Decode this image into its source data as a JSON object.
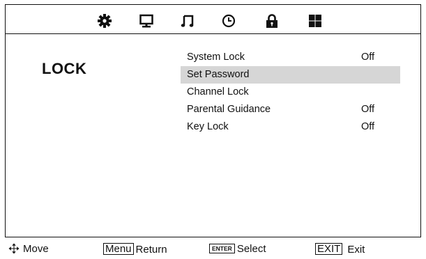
{
  "top_icons": [
    "settings-icon",
    "picture-icon",
    "audio-icon",
    "time-icon",
    "lock-icon",
    "app-grid-icon"
  ],
  "section_title": "LOCK",
  "menu": [
    {
      "label": "System Lock",
      "value": "Off",
      "selected": false
    },
    {
      "label": "Set  Password",
      "value": "",
      "selected": true
    },
    {
      "label": "Channel Lock",
      "value": "",
      "selected": false
    },
    {
      "label": "Parental Guidance",
      "value": "Off",
      "selected": false
    },
    {
      "label": "Key Lock",
      "value": "Off",
      "selected": false
    }
  ],
  "footer": {
    "move": {
      "icon": "move-arrows-icon",
      "label": "Move"
    },
    "return": {
      "key": "Menu",
      "label": "Return"
    },
    "select": {
      "key": "ENTER",
      "label": "Select"
    },
    "exit": {
      "key": "EXIT",
      "label": "Exit"
    }
  },
  "colors": {
    "highlight": "#d6d6d6",
    "foreground": "#111111",
    "background": "#ffffff"
  }
}
